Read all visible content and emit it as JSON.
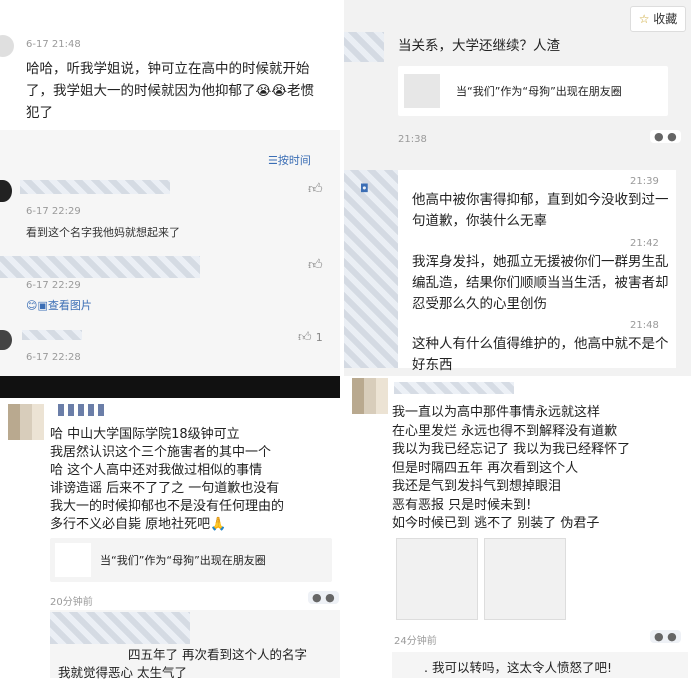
{
  "bookmark": {
    "label": "收藏",
    "icon": "star-icon"
  },
  "top_left": {
    "time1": "6-17 21:48",
    "post": "哈哈，听我学姐说，钟可立在高中的时候就开始了，我学姐大一的时候就因为他抑郁了😭😭老惯犯了",
    "sort_label": "按时间",
    "c1_time": "6-17 22:29",
    "c1_text": "看到这个名字我他妈就想起来了",
    "c2_time": "6-17 22:29",
    "c2_view_images": "查看图片",
    "c3_like_count": "1",
    "c3_time": "6-17 22:28"
  },
  "top_right": {
    "header_text": "当关系，大学还继续？人渣",
    "link_card_text": "当“我们”作为“母狗”出现在朋友圈",
    "time_sep": "21:38",
    "msg1_time": "21:39",
    "msg1_text": "他高中被你害得抑郁，直到如今没收到过一句道歉，你装什么无辜",
    "msg2_time": "21:42",
    "msg2_text": "我浑身发抖，她孤立无援被你们一群男生乱编乱造，结果你们顺顺当当生活，被害者却忍受那么久的心里创伤",
    "msg3_time": "21:48",
    "msg3_text": "这种人有什么值得维护的，他高中就不是个好东西"
  },
  "bottom_left": {
    "post_lines": [
      "哈 中山大学国际学院18级钟可立",
      "我居然认识这个三个施害者的其中一个",
      "哈 这个人高中还对我做过相似的事情",
      "诽谤造谣 后来不了了之 一句道歉也没有",
      "我大一的时候抑郁也不是没有任何理由的",
      "多行不义必自毙 原地社死吧🙏"
    ],
    "link_card_text": "当“我们”作为“母狗”出现在朋友圈",
    "time_ago": "20分钟前",
    "comment_line1": "四五年了 再次看到这个人的名字",
    "comment_line2": "我就觉得恶心 太生气了"
  },
  "bottom_right": {
    "post_lines": [
      "我一直以为高中那件事情永远就这样",
      "在心里发烂 永远也得不到解释没有道歉",
      "我以为我已经忘记了 我以为我已经释怀了",
      "但是时隔四五年 再次看到这个人",
      "我还是气到发抖气到想掉眼泪",
      "恶有恶报 只是时候未到!",
      "如今时候已到 逃不了 别装了 伪君子"
    ],
    "time_ago": "24分钟前",
    "comment": ". 我可以转吗，这太令人愤怒了吧!"
  },
  "icons": {
    "like": "thumbs-up-icon",
    "sort": "sort-icon",
    "more": "more-dots-icon",
    "image": "image-icon"
  },
  "colors": {
    "link": "#3b6eb5",
    "accent_gold": "#c9a227"
  }
}
